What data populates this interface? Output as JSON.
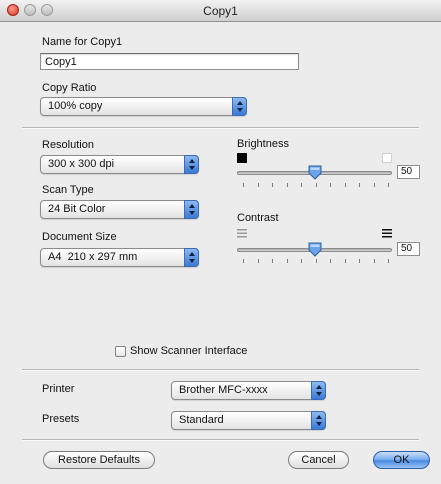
{
  "window": {
    "title": "Copy1"
  },
  "name_field": {
    "label": "Name for Copy1",
    "value": "Copy1"
  },
  "copy_ratio": {
    "label": "Copy Ratio",
    "value": "100% copy"
  },
  "resolution": {
    "label": "Resolution",
    "value": "300 x 300 dpi"
  },
  "scan_type": {
    "label": "Scan Type",
    "value": "24 Bit Color"
  },
  "document_size": {
    "label": "Document Size",
    "value": "A4  210 x 297 mm"
  },
  "brightness": {
    "label": "Brightness",
    "value": "50",
    "level": 0.5
  },
  "contrast": {
    "label": "Contrast",
    "value": "50",
    "level": 0.5
  },
  "show_scanner": {
    "label": "Show Scanner Interface",
    "checked": false
  },
  "printer": {
    "label": "Printer",
    "value": "Brother MFC-xxxx"
  },
  "presets": {
    "label": "Presets",
    "value": "Standard"
  },
  "buttons": {
    "restore": "Restore Defaults",
    "cancel": "Cancel",
    "ok": "OK"
  }
}
